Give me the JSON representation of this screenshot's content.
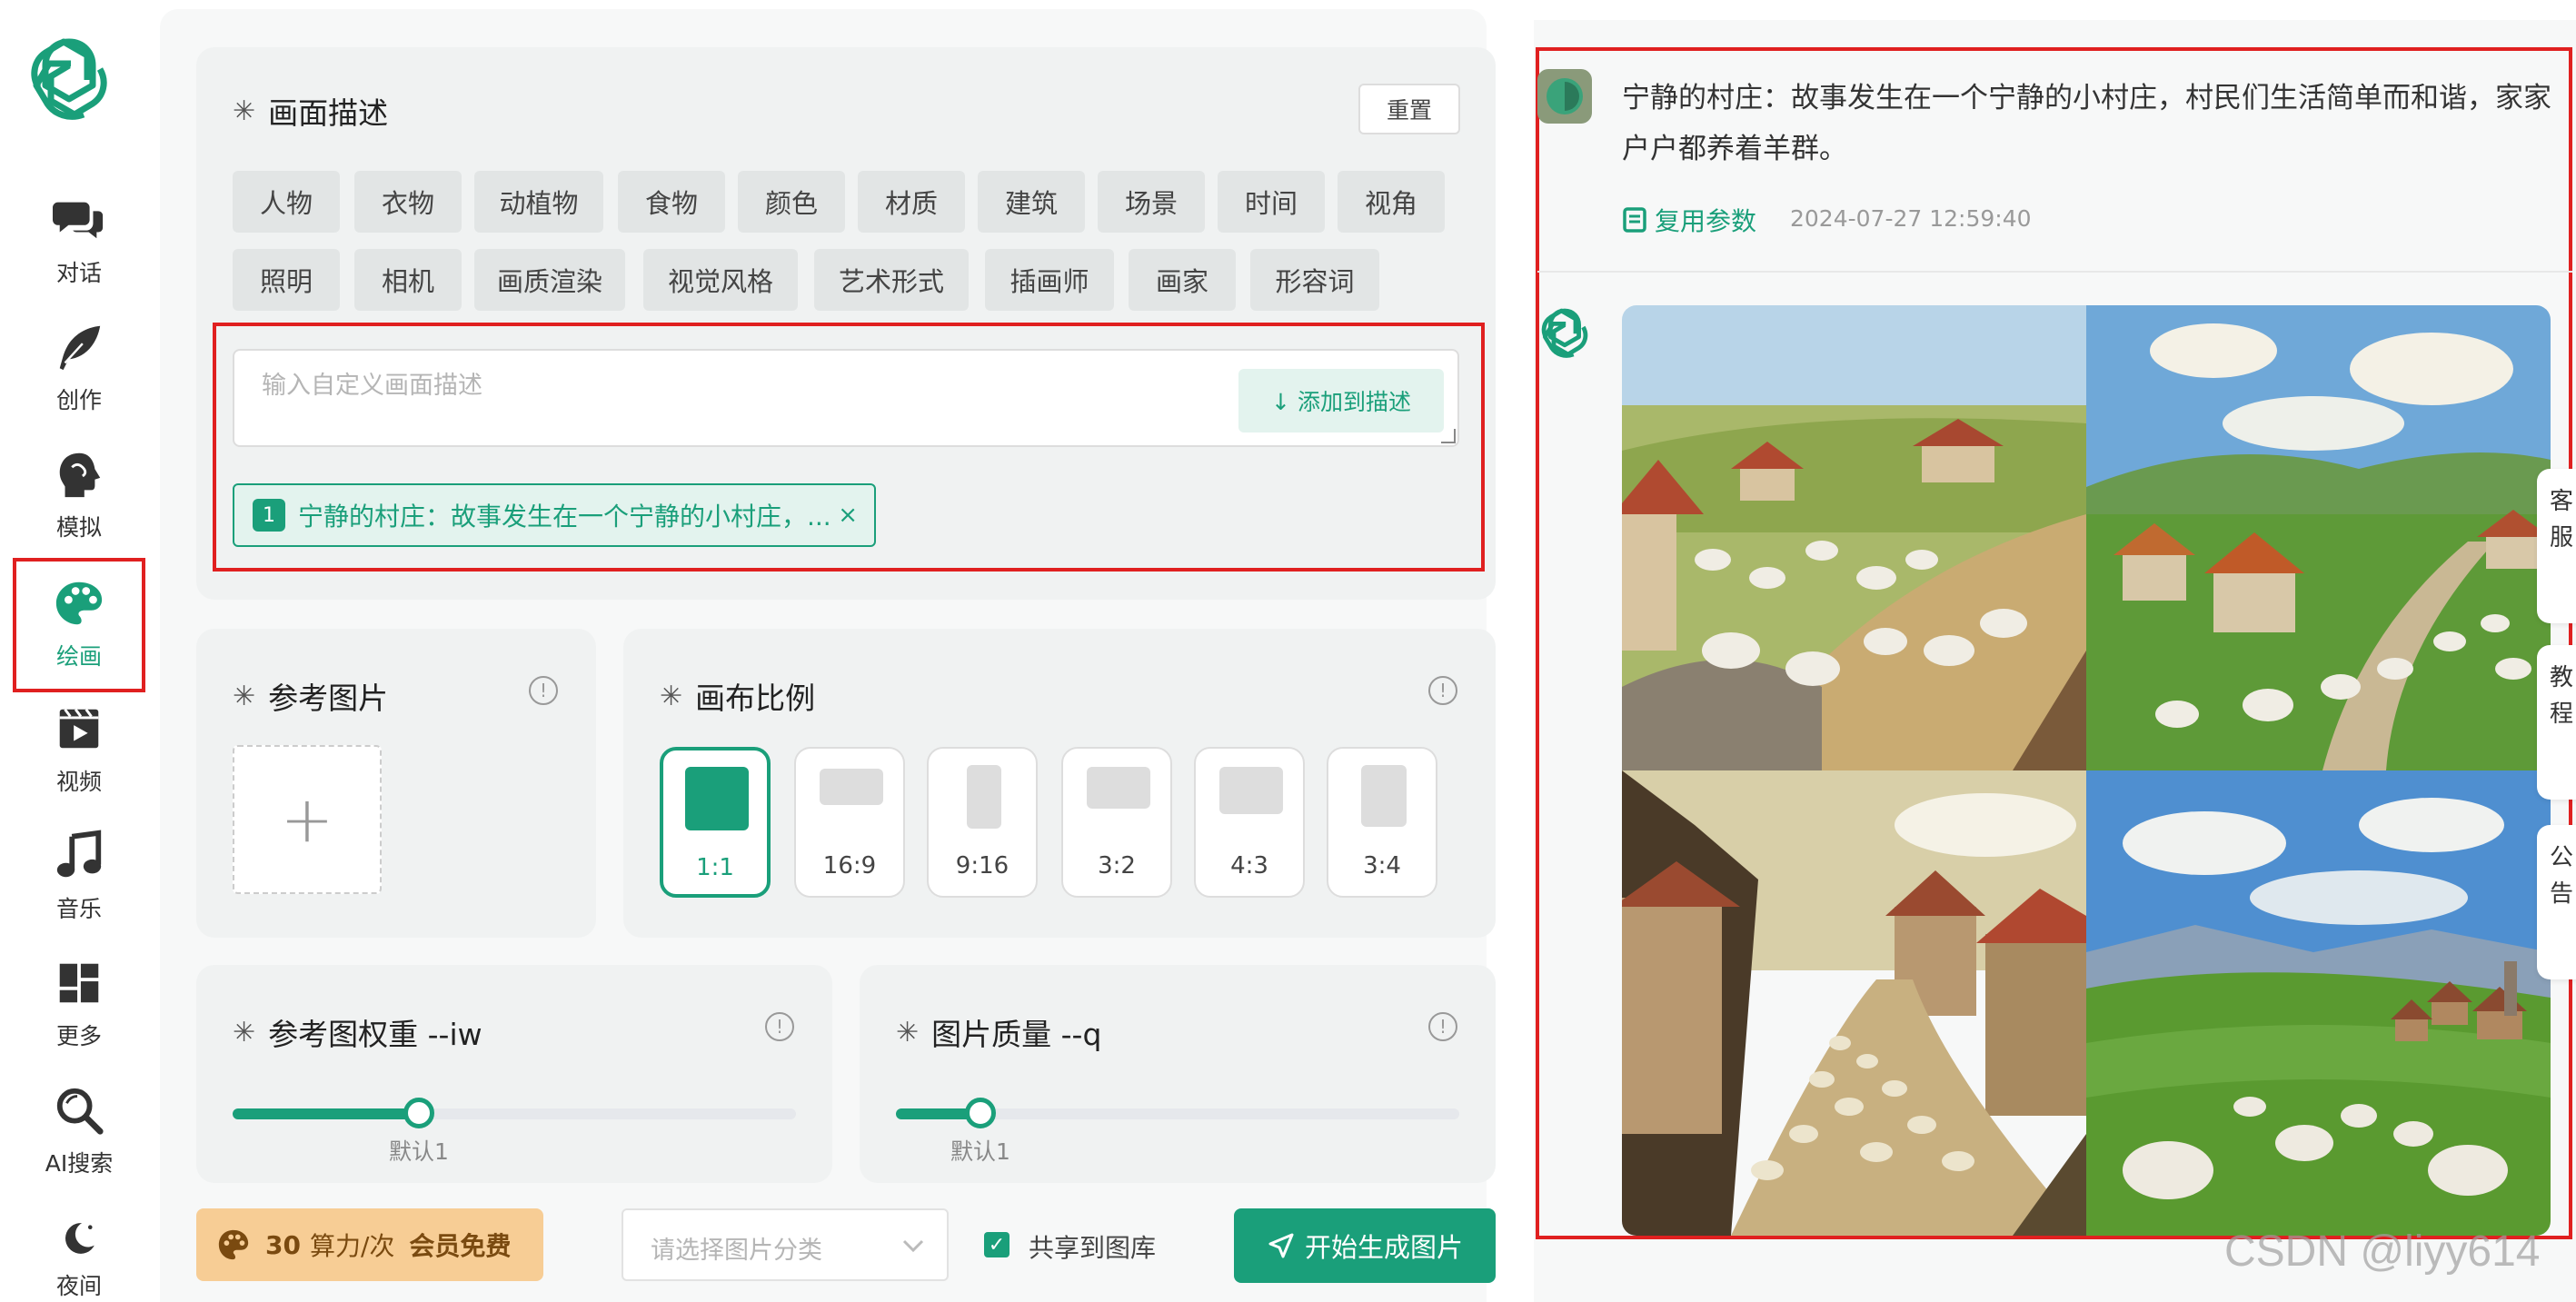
{
  "sidebar": {
    "items": [
      {
        "label": "对话",
        "icon": "chat-bubbles-icon"
      },
      {
        "label": "创作",
        "icon": "feather-pen-icon"
      },
      {
        "label": "模拟",
        "icon": "head-profile-icon"
      },
      {
        "label": "绘画",
        "icon": "palette-icon",
        "active": true
      },
      {
        "label": "视频",
        "icon": "video-clapper-icon"
      },
      {
        "label": "音乐",
        "icon": "music-note-icon"
      },
      {
        "label": "更多",
        "icon": "grid-blocks-icon"
      },
      {
        "label": "AI搜索",
        "icon": "search-icon"
      },
      {
        "label": "夜间",
        "icon": "moon-icon"
      }
    ]
  },
  "description": {
    "title": "画面描述",
    "reset_label": "重置",
    "tags_row1": [
      "人物",
      "衣物",
      "动植物",
      "食物",
      "颜色",
      "材质",
      "建筑",
      "场景",
      "时间",
      "视角"
    ],
    "tags_row2": [
      "照明",
      "相机",
      "画质渲染",
      "视觉风格",
      "艺术形式",
      "插画师",
      "画家",
      "形容词"
    ],
    "input_placeholder": "输入自定义画面描述",
    "add_button": "↓ 添加到描述",
    "chip_number": "1",
    "chip_text": "宁静的村庄：故事发生在一个宁静的小村庄，...",
    "chip_close": "×"
  },
  "reference_image": {
    "title": "参考图片",
    "upload_symbol": "+"
  },
  "canvas_ratio": {
    "title": "画布比例",
    "options": [
      "1:1",
      "16:9",
      "9:16",
      "3:2",
      "4:3",
      "3:4"
    ],
    "selected": "1:1"
  },
  "iw": {
    "title": "参考图权重 --iw",
    "default_label": "默认1",
    "fraction": 0.33
  },
  "quality": {
    "title": "图片质量 --q",
    "default_label": "默认1",
    "fraction": 0.15
  },
  "bottom": {
    "cost_number": "30",
    "cost_unit": "算力/次",
    "cost_free": "会员免费",
    "category_placeholder": "请选择图片分类",
    "share_label": "共享到图库",
    "generate_label": "开始生成图片"
  },
  "result": {
    "prompt": "宁静的村庄：故事发生在一个宁静的小村庄，村民们生活简单而和谐，家家户户都养着羊群。",
    "reuse_label": "复用参数",
    "timestamp": "2024-07-27 12:59:40"
  },
  "side_tabs": [
    "客服",
    "教程",
    "公告"
  ],
  "watermark": "CSDN @liyy614",
  "colors": {
    "accent": "#1a9f7a",
    "highlight_box": "#e02020",
    "cost_pill": "#f7cd95"
  }
}
